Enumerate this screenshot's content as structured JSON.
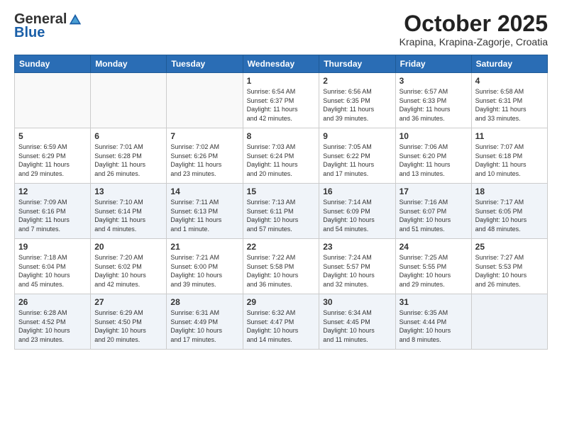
{
  "header": {
    "logo_general": "General",
    "logo_blue": "Blue",
    "month_title": "October 2025",
    "location": "Krapina, Krapina-Zagorje, Croatia"
  },
  "days_of_week": [
    "Sunday",
    "Monday",
    "Tuesday",
    "Wednesday",
    "Thursday",
    "Friday",
    "Saturday"
  ],
  "weeks": [
    {
      "shade": false,
      "days": [
        {
          "num": "",
          "info": ""
        },
        {
          "num": "",
          "info": ""
        },
        {
          "num": "",
          "info": ""
        },
        {
          "num": "1",
          "info": "Sunrise: 6:54 AM\nSunset: 6:37 PM\nDaylight: 11 hours\nand 42 minutes."
        },
        {
          "num": "2",
          "info": "Sunrise: 6:56 AM\nSunset: 6:35 PM\nDaylight: 11 hours\nand 39 minutes."
        },
        {
          "num": "3",
          "info": "Sunrise: 6:57 AM\nSunset: 6:33 PM\nDaylight: 11 hours\nand 36 minutes."
        },
        {
          "num": "4",
          "info": "Sunrise: 6:58 AM\nSunset: 6:31 PM\nDaylight: 11 hours\nand 33 minutes."
        }
      ]
    },
    {
      "shade": false,
      "days": [
        {
          "num": "5",
          "info": "Sunrise: 6:59 AM\nSunset: 6:29 PM\nDaylight: 11 hours\nand 29 minutes."
        },
        {
          "num": "6",
          "info": "Sunrise: 7:01 AM\nSunset: 6:28 PM\nDaylight: 11 hours\nand 26 minutes."
        },
        {
          "num": "7",
          "info": "Sunrise: 7:02 AM\nSunset: 6:26 PM\nDaylight: 11 hours\nand 23 minutes."
        },
        {
          "num": "8",
          "info": "Sunrise: 7:03 AM\nSunset: 6:24 PM\nDaylight: 11 hours\nand 20 minutes."
        },
        {
          "num": "9",
          "info": "Sunrise: 7:05 AM\nSunset: 6:22 PM\nDaylight: 11 hours\nand 17 minutes."
        },
        {
          "num": "10",
          "info": "Sunrise: 7:06 AM\nSunset: 6:20 PM\nDaylight: 11 hours\nand 13 minutes."
        },
        {
          "num": "11",
          "info": "Sunrise: 7:07 AM\nSunset: 6:18 PM\nDaylight: 11 hours\nand 10 minutes."
        }
      ]
    },
    {
      "shade": true,
      "days": [
        {
          "num": "12",
          "info": "Sunrise: 7:09 AM\nSunset: 6:16 PM\nDaylight: 11 hours\nand 7 minutes."
        },
        {
          "num": "13",
          "info": "Sunrise: 7:10 AM\nSunset: 6:14 PM\nDaylight: 11 hours\nand 4 minutes."
        },
        {
          "num": "14",
          "info": "Sunrise: 7:11 AM\nSunset: 6:13 PM\nDaylight: 11 hours\nand 1 minute."
        },
        {
          "num": "15",
          "info": "Sunrise: 7:13 AM\nSunset: 6:11 PM\nDaylight: 10 hours\nand 57 minutes."
        },
        {
          "num": "16",
          "info": "Sunrise: 7:14 AM\nSunset: 6:09 PM\nDaylight: 10 hours\nand 54 minutes."
        },
        {
          "num": "17",
          "info": "Sunrise: 7:16 AM\nSunset: 6:07 PM\nDaylight: 10 hours\nand 51 minutes."
        },
        {
          "num": "18",
          "info": "Sunrise: 7:17 AM\nSunset: 6:05 PM\nDaylight: 10 hours\nand 48 minutes."
        }
      ]
    },
    {
      "shade": false,
      "days": [
        {
          "num": "19",
          "info": "Sunrise: 7:18 AM\nSunset: 6:04 PM\nDaylight: 10 hours\nand 45 minutes."
        },
        {
          "num": "20",
          "info": "Sunrise: 7:20 AM\nSunset: 6:02 PM\nDaylight: 10 hours\nand 42 minutes."
        },
        {
          "num": "21",
          "info": "Sunrise: 7:21 AM\nSunset: 6:00 PM\nDaylight: 10 hours\nand 39 minutes."
        },
        {
          "num": "22",
          "info": "Sunrise: 7:22 AM\nSunset: 5:58 PM\nDaylight: 10 hours\nand 36 minutes."
        },
        {
          "num": "23",
          "info": "Sunrise: 7:24 AM\nSunset: 5:57 PM\nDaylight: 10 hours\nand 32 minutes."
        },
        {
          "num": "24",
          "info": "Sunrise: 7:25 AM\nSunset: 5:55 PM\nDaylight: 10 hours\nand 29 minutes."
        },
        {
          "num": "25",
          "info": "Sunrise: 7:27 AM\nSunset: 5:53 PM\nDaylight: 10 hours\nand 26 minutes."
        }
      ]
    },
    {
      "shade": true,
      "days": [
        {
          "num": "26",
          "info": "Sunrise: 6:28 AM\nSunset: 4:52 PM\nDaylight: 10 hours\nand 23 minutes."
        },
        {
          "num": "27",
          "info": "Sunrise: 6:29 AM\nSunset: 4:50 PM\nDaylight: 10 hours\nand 20 minutes."
        },
        {
          "num": "28",
          "info": "Sunrise: 6:31 AM\nSunset: 4:49 PM\nDaylight: 10 hours\nand 17 minutes."
        },
        {
          "num": "29",
          "info": "Sunrise: 6:32 AM\nSunset: 4:47 PM\nDaylight: 10 hours\nand 14 minutes."
        },
        {
          "num": "30",
          "info": "Sunrise: 6:34 AM\nSunset: 4:45 PM\nDaylight: 10 hours\nand 11 minutes."
        },
        {
          "num": "31",
          "info": "Sunrise: 6:35 AM\nSunset: 4:44 PM\nDaylight: 10 hours\nand 8 minutes."
        },
        {
          "num": "",
          "info": ""
        }
      ]
    }
  ]
}
